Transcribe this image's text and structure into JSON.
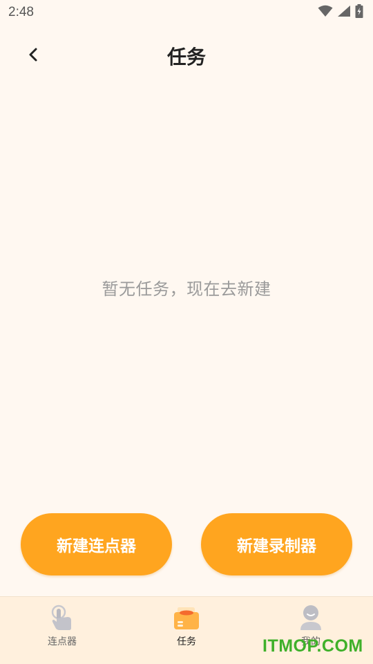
{
  "status_bar": {
    "time": "2:48",
    "icons": [
      "wifi-icon",
      "signal-icon",
      "battery-charging-icon"
    ]
  },
  "header": {
    "back_icon": "chevron-left-icon",
    "title": "任务"
  },
  "empty_state": {
    "message": "暂无任务，现在去新建"
  },
  "actions": {
    "new_clicker_label": "新建连点器",
    "new_recorder_label": "新建录制器"
  },
  "bottom_nav": {
    "items": [
      {
        "label": "连点器",
        "icon": "tap-hand-icon",
        "active": false
      },
      {
        "label": "任务",
        "icon": "task-folder-icon",
        "active": true
      },
      {
        "label": "我的",
        "icon": "user-profile-icon",
        "active": false
      }
    ]
  },
  "watermark": "ITMOP.COM",
  "colors": {
    "background": "#FFF8F1",
    "accent": "#FFA51F",
    "nav_background": "#FFF0DD",
    "watermark": "#3FB02A"
  }
}
